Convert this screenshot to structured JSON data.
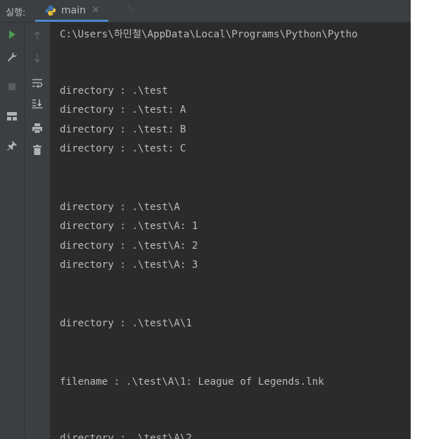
{
  "run_panel": {
    "label": "실행:",
    "tab": {
      "name": "main"
    }
  },
  "console_lines": [
    "C:\\Users\\하민철\\AppData\\Local\\Programs\\Python\\Pytho",
    "directory : .\\test",
    "directory : .\\test: A",
    "directory : .\\test: B",
    "directory : .\\test: C",
    "directory : .\\test\\A",
    "directory : .\\test\\A: 1",
    "directory : .\\test\\A: 2",
    "directory : .\\test\\A: 3",
    "directory : .\\test\\A\\1",
    "filename : .\\test\\A\\1: League of Legends.lnk",
    "directory : .\\test\\A\\2"
  ],
  "colors": {
    "console_bg": "#2b2b2b",
    "panel_bg": "#3c3f41",
    "text": "#bbbbbb",
    "run_green": "#499c54",
    "tab_underline": "#4a88c7"
  }
}
